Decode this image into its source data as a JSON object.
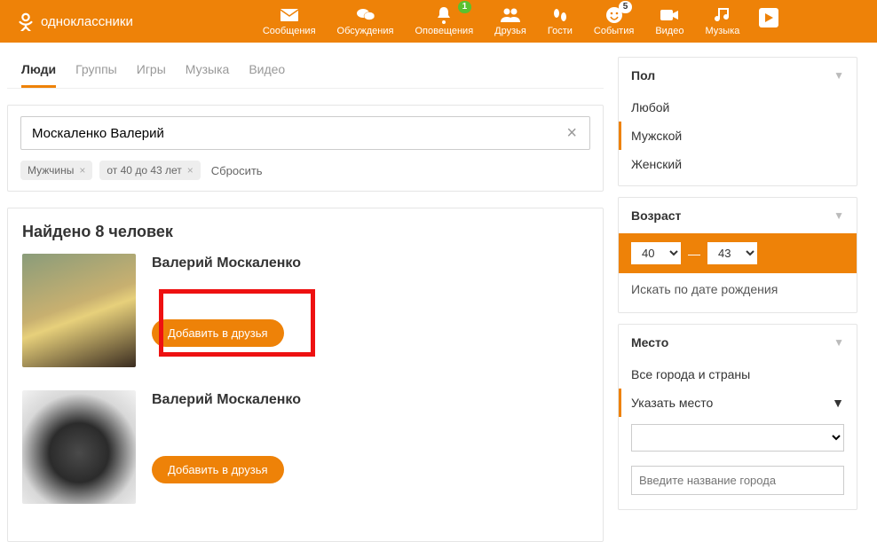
{
  "header": {
    "site_name": "одноклассники",
    "nav": [
      {
        "label": "Сообщения"
      },
      {
        "label": "Обсуждения"
      },
      {
        "label": "Оповещения",
        "badge": "1"
      },
      {
        "label": "Друзья"
      },
      {
        "label": "Гости"
      },
      {
        "label": "События",
        "badge": "5"
      },
      {
        "label": "Видео"
      },
      {
        "label": "Музыка"
      }
    ]
  },
  "tabs": [
    "Люди",
    "Группы",
    "Игры",
    "Музыка",
    "Видео"
  ],
  "active_tab": "Люди",
  "search": {
    "value": "Москаленко Валерий",
    "chips": [
      "Мужчины",
      "от 40 до 43 лет"
    ],
    "reset": "Сбросить"
  },
  "results": {
    "title": "Найдено 8 человек",
    "items": [
      {
        "name": "Валерий Москаленко",
        "button": "Добавить в друзья",
        "highlight": true
      },
      {
        "name": "Валерий Москаленко",
        "button": "Добавить в друзья",
        "highlight": false
      }
    ]
  },
  "filters": {
    "gender": {
      "title": "Пол",
      "options": [
        "Любой",
        "Мужской",
        "Женский"
      ],
      "selected": "Мужской"
    },
    "age": {
      "title": "Возраст",
      "from": "40",
      "to": "43",
      "bd_link": "Искать по дате рождения"
    },
    "place": {
      "title": "Место",
      "option_all": "Все города и страны",
      "option_pick": "Указать место",
      "city_placeholder": "Введите название города"
    }
  }
}
